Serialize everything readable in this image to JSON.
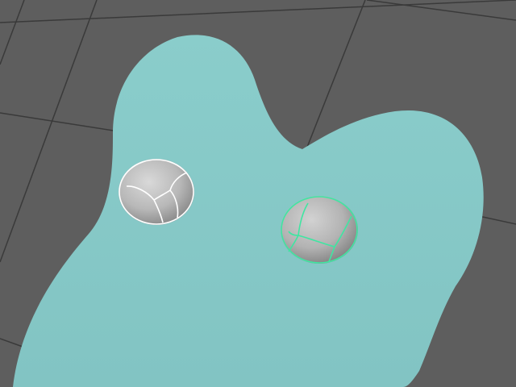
{
  "viewport": {
    "background_color": "#5e5e5e",
    "grid_color": "#3a3a3a"
  },
  "mesh": {
    "name": "blob-mesh",
    "body_color": "#86c8c7",
    "body_shadow_color": "#6fb1b0"
  },
  "spheres": [
    {
      "name": "left-eye-sphere",
      "fill_color": "#b8b8b8",
      "wire_color": "#ffffff",
      "selected": false
    },
    {
      "name": "right-eye-sphere",
      "fill_color": "#b3b3b3",
      "wire_color": "#3fe6a2",
      "selected": true
    }
  ]
}
